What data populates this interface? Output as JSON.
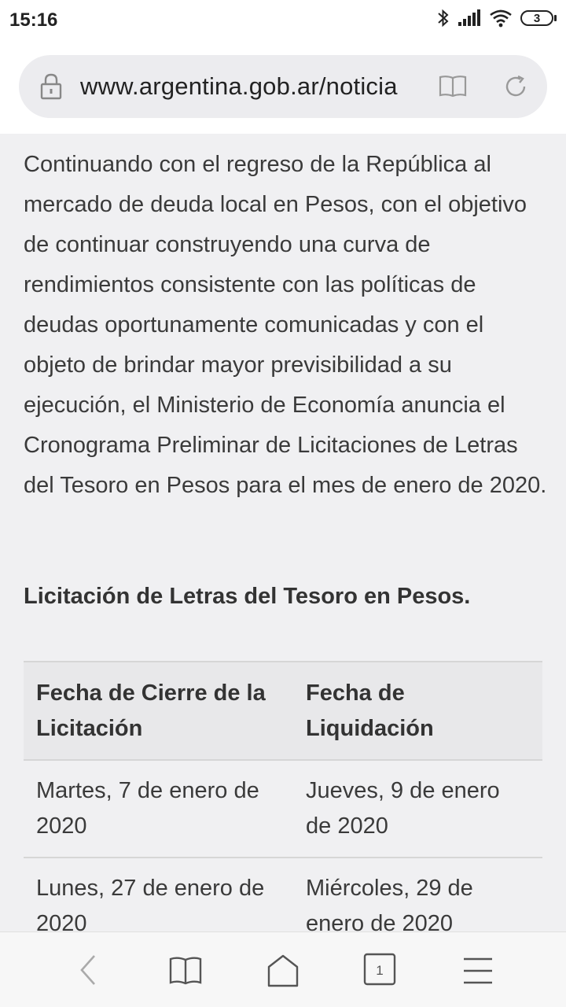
{
  "status_bar": {
    "time": "15:16",
    "battery_level": "3",
    "icons": [
      "bluetooth-icon",
      "signal-icon",
      "wifi-icon",
      "battery-icon"
    ]
  },
  "browser": {
    "url": "www.argentina.gob.ar/noticia",
    "icons": [
      "lock-icon",
      "reader-mode-icon",
      "reload-icon"
    ]
  },
  "article": {
    "paragraph": "Continuando con el regreso de la República al mercado de deuda local en Pesos, con el objetivo de continuar construyendo una curva de rendimientos consistente con las políticas de deudas oportunamente comunicadas y con el objeto de brindar mayor previsibilidad a su ejecución, el Ministerio de Economía anuncia el Cronograma Preliminar de Licitaciones de Letras del Tesoro en Pesos para el mes de enero de 2020.",
    "heading": "Licitación de Letras del Tesoro en Pesos.",
    "table": {
      "headers": [
        "Fecha de Cierre de la Licitación",
        "Fecha de Liquidación"
      ],
      "rows": [
        [
          "Martes, 7 de enero de 2020",
          "Jueves, 9 de enero de 2020"
        ],
        [
          "Lunes, 27 de enero de 2020",
          "Miércoles, 29 de enero de 2020"
        ]
      ]
    }
  },
  "bottom_nav": {
    "tab_count": "1",
    "icons": [
      "back-icon",
      "bookmarks-icon",
      "home-icon",
      "tabs-icon",
      "menu-icon"
    ]
  },
  "colors": {
    "background": "#f0f0f2",
    "text": "#3a3a3a",
    "table_header": "#e8e8ea",
    "url_pill": "#ececef"
  }
}
